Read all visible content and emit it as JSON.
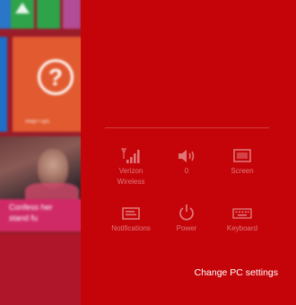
{
  "start_screen": {
    "help_tile_label": "Help+Tips",
    "news_caption": "Confess her\nstand fu"
  },
  "settings_charm": {
    "background_color": "#c50409",
    "quick_settings": [
      {
        "label": "Verizon\nWireless",
        "icon": "signal-bars-icon"
      },
      {
        "label": "0",
        "icon": "volume-icon"
      },
      {
        "label": "Screen",
        "icon": "screen-icon"
      },
      {
        "label": "Notifications",
        "icon": "notifications-icon"
      },
      {
        "label": "Power",
        "icon": "power-icon"
      },
      {
        "label": "Keyboard",
        "icon": "keyboard-icon"
      }
    ],
    "change_pc_settings": "Change PC settings"
  }
}
